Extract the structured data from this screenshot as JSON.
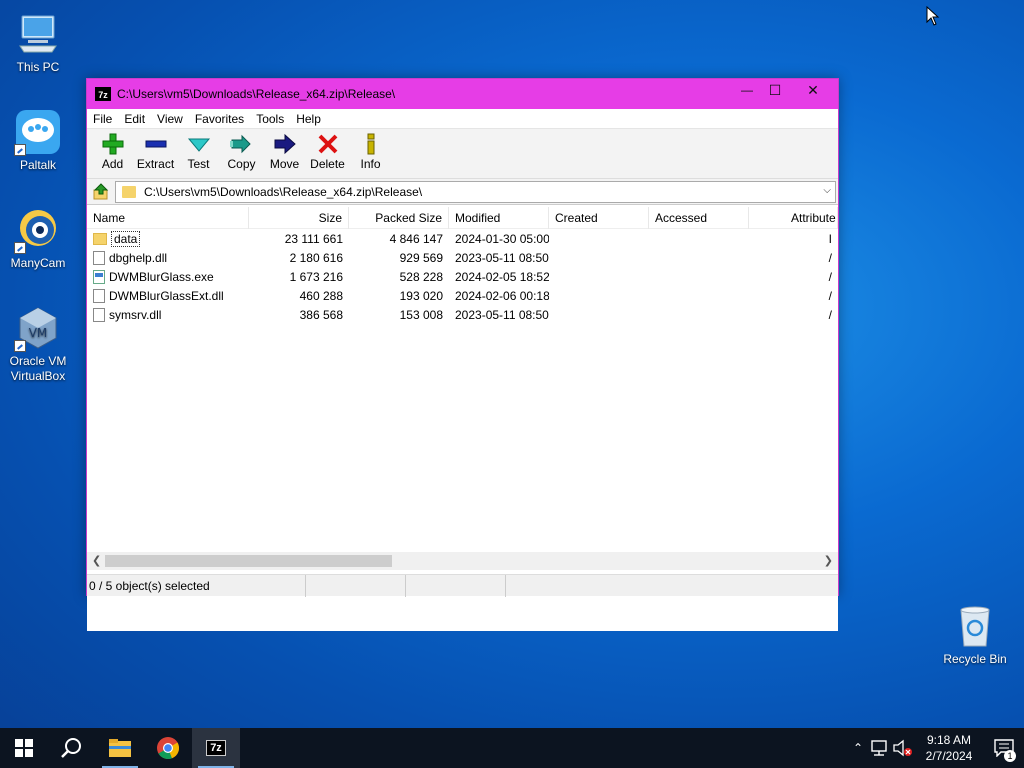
{
  "desktop": {
    "icons": [
      {
        "label": "This PC"
      },
      {
        "label": "Paltalk"
      },
      {
        "label": "ManyCam"
      },
      {
        "label": "Oracle VM VirtualBox"
      },
      {
        "label": "Recycle Bin"
      }
    ]
  },
  "window": {
    "app_icon": "7z",
    "title": "C:\\Users\\vm5\\Downloads\\Release_x64.zip\\Release\\",
    "controls": {
      "minimize": "—",
      "maximize": "☐",
      "close": "✕"
    },
    "menu": [
      "File",
      "Edit",
      "View",
      "Favorites",
      "Tools",
      "Help"
    ],
    "toolbar": [
      {
        "label": "Add",
        "icon": "plus-icon",
        "color": "#22aa22"
      },
      {
        "label": "Extract",
        "icon": "minus-icon",
        "color": "#1a2fb0"
      },
      {
        "label": "Test",
        "icon": "check-icon",
        "color": "#1ab0b0"
      },
      {
        "label": "Copy",
        "icon": "double-arrow-icon",
        "color": "#1a9a8a"
      },
      {
        "label": "Move",
        "icon": "arrow-right-icon",
        "color": "#1a1a80"
      },
      {
        "label": "Delete",
        "icon": "x-icon",
        "color": "#dd1111"
      },
      {
        "label": "Info",
        "icon": "info-icon",
        "color": "#c8b400"
      }
    ],
    "address": "C:\\Users\\vm5\\Downloads\\Release_x64.zip\\Release\\",
    "columns": [
      "Name",
      "Size",
      "Packed Size",
      "Modified",
      "Created",
      "Accessed",
      "Attribute"
    ],
    "files": [
      {
        "name": "data",
        "size": "23 111 661",
        "packed": "4 846 147",
        "modified": "2024-01-30 05:00",
        "type": "folder",
        "attr": "I"
      },
      {
        "name": "dbghelp.dll",
        "size": "2 180 616",
        "packed": "929 569",
        "modified": "2023-05-11 08:50",
        "type": "dll",
        "attr": "/"
      },
      {
        "name": "DWMBlurGlass.exe",
        "size": "1 673 216",
        "packed": "528 228",
        "modified": "2024-02-05 18:52",
        "type": "exe",
        "attr": "/"
      },
      {
        "name": "DWMBlurGlassExt.dll",
        "size": "460 288",
        "packed": "193 020",
        "modified": "2024-02-06 00:18",
        "type": "dll",
        "attr": "/"
      },
      {
        "name": "symsrv.dll",
        "size": "386 568",
        "packed": "153 008",
        "modified": "2023-05-11 08:50",
        "type": "dll",
        "attr": "/"
      }
    ],
    "status": "0 / 5 object(s) selected"
  },
  "taskbar": {
    "time": "9:18 AM",
    "date": "2/7/2024",
    "notification_count": "1",
    "apps": [
      "start-icon",
      "search-icon",
      "file-explorer-icon",
      "chrome-icon",
      "7zip-icon"
    ]
  }
}
